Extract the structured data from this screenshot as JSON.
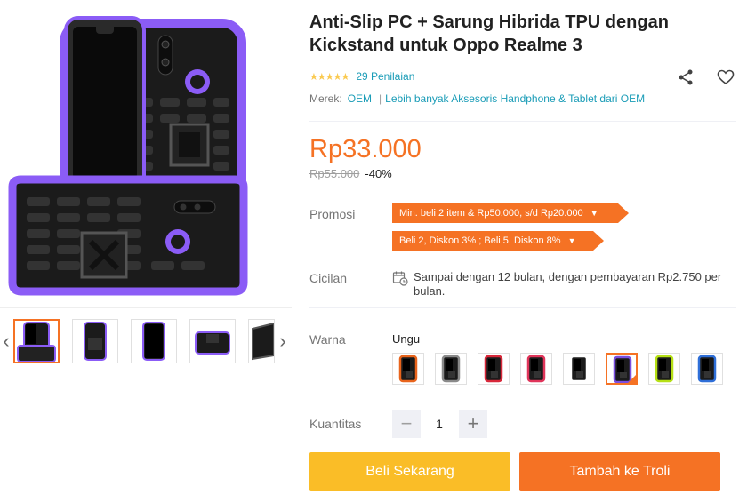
{
  "product": {
    "title": "Anti-Slip PC + Sarung Hibrida TPU dengan Kickstand untuk Oppo Realme 3",
    "stars": "★★★★★",
    "rating_count": "29 Penilaian",
    "brand_label": "Merek:",
    "brand": "OEM",
    "brand_more": "Lebih banyak Aksesoris Handphone & Tablet dari OEM",
    "price": "Rp33.000",
    "old_price": "Rp55.000",
    "discount": "-40%",
    "rating_value": 4.5
  },
  "promotions": {
    "label": "Promosi",
    "items": [
      "Min. beli 2 item & Rp50.000, s/d Rp20.000",
      "Beli 2, Diskon 3% ; Beli 5, Diskon 8%"
    ]
  },
  "installment": {
    "label": "Cicilan",
    "text": "Sampai dengan 12 bulan, dengan pembayaran Rp2.750 per bulan."
  },
  "color": {
    "label": "Warna",
    "selected": "Ungu",
    "swatch_accents": [
      "#e8641c",
      "#8a8a8a",
      "#d8283a",
      "#e0355a",
      "#ffffff",
      "#7b4fe0",
      "#b6e016",
      "#2f6fd8"
    ],
    "selected_index": 5
  },
  "quantity": {
    "label": "Kuantitas",
    "value": "1",
    "minus": "−",
    "plus": "+"
  },
  "actions": {
    "buy_now": "Beli Sekarang",
    "add_to_cart": "Tambah ke Troli"
  },
  "colors": {
    "accent": "#f57224",
    "buy_button": "#fabd27",
    "link": "#1a9cb7",
    "star": "#faca51",
    "product_purple": "#8b5cf6"
  }
}
